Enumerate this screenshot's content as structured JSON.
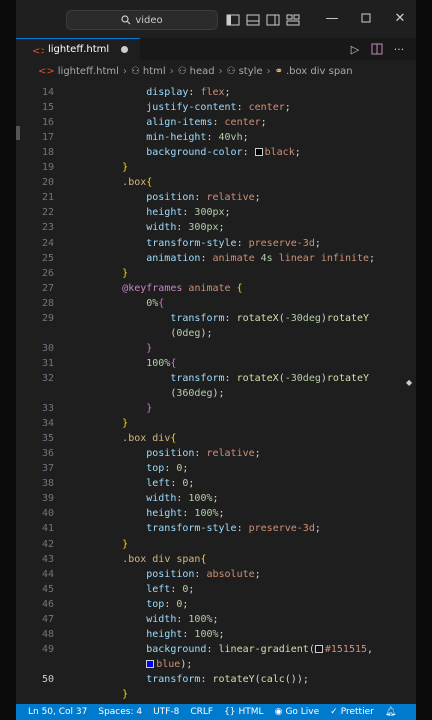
{
  "titlebar": {
    "search_text": "video",
    "icons": [
      "search-icon",
      "toggle-sidebar-icon",
      "toggle-panel-icon",
      "toggle-secondary-icon",
      "customize-layout-icon"
    ],
    "window_controls": [
      "minimize-icon",
      "maximize-icon",
      "close-icon"
    ]
  },
  "tab": {
    "filename": "lighteff.html",
    "dirty": true
  },
  "tab_actions": [
    "run-icon",
    "split-editor-icon",
    "more-actions-icon"
  ],
  "breadcrumb": {
    "items": [
      "lighteff.html",
      "html",
      "head",
      "style",
      ".box div span"
    ]
  },
  "editor": {
    "lines": [
      {
        "n": "14",
        "indent": "            ",
        "tokens": [
          [
            "prop",
            "display"
          ],
          [
            "plain",
            ": "
          ],
          [
            "val",
            "flex"
          ],
          [
            "plain",
            ";"
          ]
        ]
      },
      {
        "n": "15",
        "indent": "            ",
        "tokens": [
          [
            "prop",
            "justify-content"
          ],
          [
            "plain",
            ": "
          ],
          [
            "val",
            "center"
          ],
          [
            "plain",
            ";"
          ]
        ]
      },
      {
        "n": "16",
        "indent": "            ",
        "tokens": [
          [
            "prop",
            "align-items"
          ],
          [
            "plain",
            ": "
          ],
          [
            "val",
            "center"
          ],
          [
            "plain",
            ";"
          ]
        ]
      },
      {
        "n": "17",
        "indent": "            ",
        "tokens": [
          [
            "prop",
            "min-height"
          ],
          [
            "plain",
            ": "
          ],
          [
            "num",
            "40vh"
          ],
          [
            "plain",
            ";"
          ]
        ]
      },
      {
        "n": "18",
        "indent": "            ",
        "tokens": [
          [
            "prop",
            "background-color"
          ],
          [
            "plain",
            ": "
          ],
          [
            "swatch",
            "#000000"
          ],
          [
            "val",
            "black"
          ],
          [
            "plain",
            ";"
          ]
        ]
      },
      {
        "n": "19",
        "indent": "        ",
        "tokens": [
          [
            "brace",
            "}"
          ]
        ]
      },
      {
        "n": "20",
        "indent": "        ",
        "tokens": [
          [
            "sel",
            ".box"
          ],
          [
            "brace",
            "{"
          ]
        ]
      },
      {
        "n": "21",
        "indent": "            ",
        "tokens": [
          [
            "prop",
            "position"
          ],
          [
            "plain",
            ": "
          ],
          [
            "val",
            "relative"
          ],
          [
            "plain",
            ";"
          ]
        ]
      },
      {
        "n": "22",
        "indent": "            ",
        "tokens": [
          [
            "prop",
            "height"
          ],
          [
            "plain",
            ": "
          ],
          [
            "num",
            "300px"
          ],
          [
            "plain",
            ";"
          ]
        ]
      },
      {
        "n": "23",
        "indent": "            ",
        "tokens": [
          [
            "prop",
            "width"
          ],
          [
            "plain",
            ": "
          ],
          [
            "num",
            "300px"
          ],
          [
            "plain",
            ";"
          ]
        ]
      },
      {
        "n": "24",
        "indent": "            ",
        "tokens": [
          [
            "prop",
            "transform-style"
          ],
          [
            "plain",
            ": "
          ],
          [
            "val",
            "preserve-3d"
          ],
          [
            "plain",
            ";"
          ]
        ]
      },
      {
        "n": "25",
        "indent": "            ",
        "tokens": [
          [
            "prop",
            "animation"
          ],
          [
            "plain",
            ": "
          ],
          [
            "val",
            "animate "
          ],
          [
            "num",
            "4s"
          ],
          [
            "val",
            " linear infinite"
          ],
          [
            "plain",
            ";"
          ]
        ]
      },
      {
        "n": "26",
        "indent": "        ",
        "tokens": [
          [
            "brace",
            "}"
          ]
        ]
      },
      {
        "n": "27",
        "indent": "        ",
        "tokens": [
          [
            "kw",
            "@keyframes"
          ],
          [
            "plain",
            " "
          ],
          [
            "val",
            "animate"
          ],
          [
            "plain",
            " "
          ],
          [
            "brace",
            "{"
          ]
        ]
      },
      {
        "n": "28",
        "indent": "            ",
        "tokens": [
          [
            "num",
            "0%"
          ],
          [
            "brace2",
            "{"
          ]
        ]
      },
      {
        "n": "29",
        "indent": "                ",
        "tokens": [
          [
            "prop",
            "transform"
          ],
          [
            "plain",
            ": "
          ],
          [
            "fn",
            "rotateX"
          ],
          [
            "plain",
            "("
          ],
          [
            "num",
            "-30deg"
          ],
          [
            "plain",
            ")"
          ],
          [
            "fn",
            "rotateY"
          ]
        ]
      },
      {
        "n": "",
        "indent": "                ",
        "tokens": [
          [
            "plain",
            "("
          ],
          [
            "num",
            "0deg"
          ],
          [
            "plain",
            ");"
          ]
        ]
      },
      {
        "n": "30",
        "indent": "            ",
        "tokens": [
          [
            "brace2",
            "}"
          ]
        ]
      },
      {
        "n": "31",
        "indent": "            ",
        "tokens": [
          [
            "num",
            "100%"
          ],
          [
            "brace2",
            "{"
          ]
        ]
      },
      {
        "n": "32",
        "indent": "                ",
        "tokens": [
          [
            "prop",
            "transform"
          ],
          [
            "plain",
            ": "
          ],
          [
            "fn",
            "rotateX"
          ],
          [
            "plain",
            "("
          ],
          [
            "num",
            "-30deg"
          ],
          [
            "plain",
            ")"
          ],
          [
            "fn",
            "rotateY"
          ]
        ]
      },
      {
        "n": "",
        "indent": "                ",
        "tokens": [
          [
            "plain",
            "("
          ],
          [
            "num",
            "360deg"
          ],
          [
            "plain",
            ");"
          ]
        ]
      },
      {
        "n": "33",
        "indent": "            ",
        "tokens": [
          [
            "brace2",
            "}"
          ]
        ]
      },
      {
        "n": "34",
        "indent": "        ",
        "tokens": [
          [
            "brace",
            "}"
          ]
        ]
      },
      {
        "n": "35",
        "indent": "        ",
        "tokens": [
          [
            "sel",
            ".box div"
          ],
          [
            "brace",
            "{"
          ]
        ]
      },
      {
        "n": "36",
        "indent": "            ",
        "tokens": [
          [
            "prop",
            "position"
          ],
          [
            "plain",
            ": "
          ],
          [
            "val",
            "relative"
          ],
          [
            "plain",
            ";"
          ]
        ]
      },
      {
        "n": "37",
        "indent": "            ",
        "tokens": [
          [
            "prop",
            "top"
          ],
          [
            "plain",
            ": "
          ],
          [
            "num",
            "0"
          ],
          [
            "plain",
            ";"
          ]
        ]
      },
      {
        "n": "38",
        "indent": "            ",
        "tokens": [
          [
            "prop",
            "left"
          ],
          [
            "plain",
            ": "
          ],
          [
            "num",
            "0"
          ],
          [
            "plain",
            ";"
          ]
        ]
      },
      {
        "n": "39",
        "indent": "            ",
        "tokens": [
          [
            "prop",
            "width"
          ],
          [
            "plain",
            ": "
          ],
          [
            "num",
            "100%"
          ],
          [
            "plain",
            ";"
          ]
        ]
      },
      {
        "n": "40",
        "indent": "            ",
        "tokens": [
          [
            "prop",
            "height"
          ],
          [
            "plain",
            ": "
          ],
          [
            "num",
            "100%"
          ],
          [
            "plain",
            ";"
          ]
        ]
      },
      {
        "n": "41",
        "indent": "            ",
        "tokens": [
          [
            "prop",
            "transform-style"
          ],
          [
            "plain",
            ": "
          ],
          [
            "val",
            "preserve-3d"
          ],
          [
            "plain",
            ";"
          ]
        ]
      },
      {
        "n": "42",
        "indent": "        ",
        "tokens": [
          [
            "brace",
            "}"
          ]
        ]
      },
      {
        "n": "43",
        "indent": "        ",
        "tokens": [
          [
            "sel",
            ".box div span"
          ],
          [
            "brace",
            "{"
          ]
        ]
      },
      {
        "n": "44",
        "indent": "            ",
        "tokens": [
          [
            "prop",
            "position"
          ],
          [
            "plain",
            ": "
          ],
          [
            "val",
            "absolute"
          ],
          [
            "plain",
            ";"
          ]
        ]
      },
      {
        "n": "45",
        "indent": "            ",
        "tokens": [
          [
            "prop",
            "left"
          ],
          [
            "plain",
            ": "
          ],
          [
            "num",
            "0"
          ],
          [
            "plain",
            ";"
          ]
        ]
      },
      {
        "n": "46",
        "indent": "            ",
        "tokens": [
          [
            "prop",
            "top"
          ],
          [
            "plain",
            ": "
          ],
          [
            "num",
            "0"
          ],
          [
            "plain",
            ";"
          ]
        ]
      },
      {
        "n": "47",
        "indent": "            ",
        "tokens": [
          [
            "prop",
            "width"
          ],
          [
            "plain",
            ": "
          ],
          [
            "num",
            "100%"
          ],
          [
            "plain",
            ";"
          ]
        ]
      },
      {
        "n": "48",
        "indent": "            ",
        "tokens": [
          [
            "prop",
            "height"
          ],
          [
            "plain",
            ": "
          ],
          [
            "num",
            "100%"
          ],
          [
            "plain",
            ";"
          ]
        ]
      },
      {
        "n": "49",
        "indent": "            ",
        "tokens": [
          [
            "prop",
            "background"
          ],
          [
            "plain",
            ": "
          ],
          [
            "fn",
            "linear-gradient"
          ],
          [
            "plain",
            "("
          ],
          [
            "swatch",
            "#151515"
          ],
          [
            "val",
            "#151515"
          ],
          [
            "plain",
            ","
          ]
        ]
      },
      {
        "n": "",
        "indent": "            ",
        "tokens": [
          [
            "swatch",
            "#0000ff"
          ],
          [
            "val",
            "blue"
          ],
          [
            "plain",
            ");"
          ]
        ]
      },
      {
        "n": "50",
        "indent": "            ",
        "tokens": [
          [
            "prop",
            "transform"
          ],
          [
            "plain",
            ": "
          ],
          [
            "fn",
            "rotateY"
          ],
          [
            "plain",
            "("
          ],
          [
            "fn",
            "calc"
          ],
          [
            "plain",
            "("
          ],
          [
            "plain",
            ")"
          ],
          [
            "plain",
            ");"
          ]
        ],
        "active": true
      },
      {
        "n": "",
        "indent": "        ",
        "tokens": [
          [
            "brace",
            "}"
          ]
        ]
      }
    ]
  },
  "statusbar": {
    "position": "Ln 50, Col 37",
    "spaces": "Spaces: 4",
    "encoding": "UTF-8",
    "eol": "CRLF",
    "language": "HTML",
    "golive": "Go Live",
    "prettier": "Prettier"
  },
  "colors": {
    "accent": "#007acc",
    "editor_bg": "#1e1e1e"
  }
}
